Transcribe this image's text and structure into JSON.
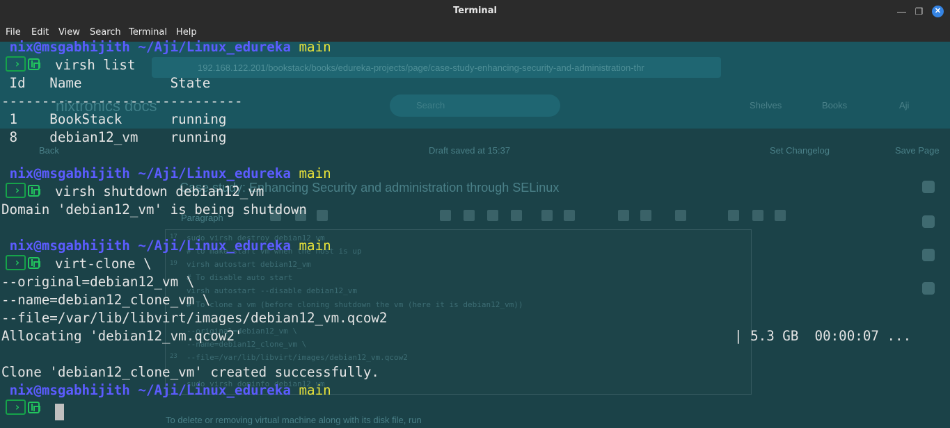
{
  "window": {
    "title": "Terminal",
    "minimize": "—",
    "maximize": "❐",
    "close": "✕"
  },
  "menu": [
    "File",
    "Edit",
    "View",
    "Search",
    "Terminal",
    "Help"
  ],
  "background_browser": {
    "url": "192.168.122.201/bookstack/books/edureka-projects/page/case-study-enhancing-security-and-administration-thr",
    "site_name": "nixtronics docs",
    "search_placeholder": "Search",
    "nav": [
      "Shelves",
      "Books",
      "Aji"
    ],
    "back": "Back",
    "draft_status": "Draft saved at 15:37",
    "set_changelog": "Set Changelog",
    "save_page": "Save Page",
    "heading": "Case study: Enhancing Security and administration through SELinux",
    "format": "Paragraph",
    "code_lines": [
      {
        "n": "17",
        "text": "sudo virsh destroy debian12_vm"
      },
      {
        "n": "",
        "text": "# to make start vm when the host is up"
      },
      {
        "n": "19",
        "text": "virsh autostart debian12_vm"
      },
      {
        "n": "",
        "text": "# To disable auto start"
      },
      {
        "n": "",
        "text": "virsh autostart --disable debian12_vm"
      },
      {
        "n": "",
        "text": "# To clone a vm (before cloning shutdown the vm (here it is debian12_vm))"
      },
      {
        "n": "",
        "text": ""
      },
      {
        "n": "",
        "text": "--original=debian12_vm \\"
      },
      {
        "n": "",
        "text": "--name=debian12_clone_vm \\"
      },
      {
        "n": "23",
        "text": "--file=/var/lib/libvirt/images/debian12_vm.qcow2"
      },
      {
        "n": "",
        "text": ""
      },
      {
        "n": "",
        "text": "sudo virsh dominfo debian12_vm"
      }
    ],
    "footer": "To delete or removing virtual machine along with its disk file, run"
  },
  "terminal": {
    "prompt_user": "nix@msgabhijith",
    "prompt_path": "~/Aji/Linux_edureka",
    "prompt_branch": "main",
    "block1": {
      "command": "virsh list",
      "header": " Id   Name           State",
      "divider": "------------------------------",
      "rows": [
        " 1    BookStack      running",
        " 8    debian12_vm    running"
      ]
    },
    "block2": {
      "command": "virsh shutdown debian12_vm",
      "output": "Domain 'debian12_vm' is being shutdown"
    },
    "block3": {
      "command": "virt-clone \\",
      "args": [
        "--original=debian12_vm \\",
        "--name=debian12_clone_vm \\",
        "--file=/var/lib/libvirt/images/debian12_vm.qcow2"
      ],
      "allocating": "Allocating 'debian12_vm.qcow2'",
      "progress": "| 5.3 GB  00:00:07 ...",
      "result": "Clone 'debian12_clone_vm' created successfully."
    }
  }
}
